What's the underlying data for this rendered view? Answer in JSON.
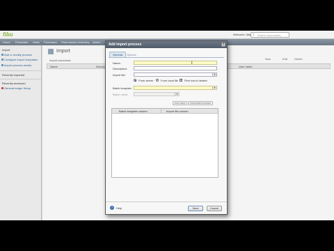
{
  "header": {
    "logo": "fibu",
    "user_label": "Welcome, Maria",
    "search_placeholder": "Search documents"
  },
  "nav": {
    "items": [
      "Home",
      "Financials",
      "Sales",
      "Purchases",
      "Fixed assets",
      "Inventory",
      "Admin"
    ]
  },
  "sidebar": {
    "section_title": "Import",
    "items": [
      "Add or modify process",
      "Configure import templates",
      "Import process results"
    ],
    "recent_title": "Recently imported",
    "recent2_title": "Recently accessed",
    "recent_items": [
      "General ledger Setup"
    ]
  },
  "main": {
    "title": "Import",
    "subtitle": "Import processes",
    "toolbar": [
      "New",
      "Edit",
      "Delete"
    ],
    "columns": [
      "Name",
      "Description",
      "Last run",
      "User name"
    ]
  },
  "dialog": {
    "title": "Add import process",
    "close_glyph": "x",
    "tabs": [
      "General",
      "Options"
    ],
    "fields": {
      "name_label": "Name:",
      "description_label": "Description:",
      "import_file_label": "Import file:",
      "batch_template_label": "Batch template:",
      "batch_name_label": "Batch name:"
    },
    "radios": {
      "server_label": "From server",
      "local_label": "From local file",
      "header_label": "First row is header"
    },
    "small_buttons": [
      "Auto match",
      "Import/Match template"
    ],
    "grid_columns": [
      "Batch template column",
      "Import file column"
    ],
    "help_label": "Help",
    "save_label": "Save",
    "cancel_label": "Cancel"
  },
  "colors": {
    "nav_bg": "#6b7785",
    "dialog_title_bg": "#4f5a68",
    "focus_field": "#fdfbc7",
    "logo": "#8fb340"
  }
}
